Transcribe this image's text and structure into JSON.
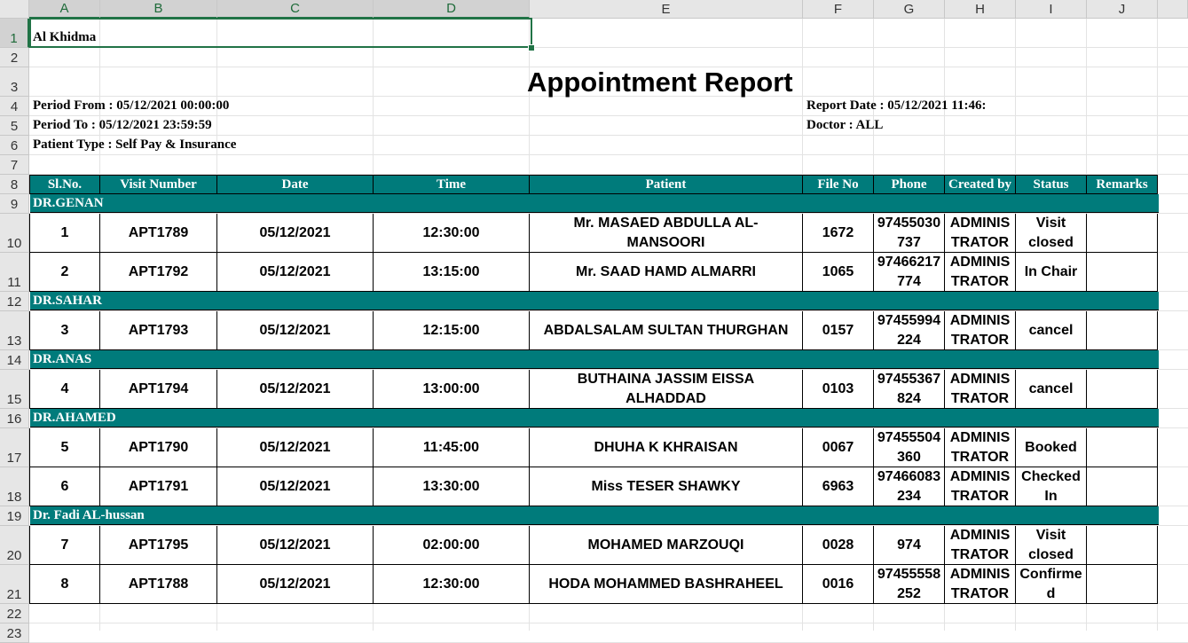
{
  "columns": [
    "A",
    "B",
    "C",
    "D",
    "E",
    "F",
    "G",
    "H",
    "I",
    "J"
  ],
  "rows": [
    "1",
    "2",
    "3",
    "4",
    "5",
    "6",
    "7",
    "8",
    "9",
    "10",
    "11",
    "12",
    "13",
    "14",
    "15",
    "16",
    "17",
    "18",
    "19",
    "20",
    "21",
    "22",
    "23"
  ],
  "company": "Al Khidma",
  "title": "Appointment Report",
  "period_from": "Period From : 05/12/2021 00:00:00",
  "period_to": "Period To : 05/12/2021 23:59:59",
  "patient_type": "Patient Type : Self Pay & Insurance",
  "report_date": "Report Date : 05/12/2021 11:46:",
  "doctor": "Doctor : ALL",
  "colors": {
    "header_fill": "#007b7b",
    "header_text": "#ffffff",
    "selection": "#217346"
  },
  "table_headers": [
    "Sl.No.",
    "Visit Number",
    "Date",
    "Time",
    "Patient",
    "File No",
    "Phone",
    "Created by",
    "Status",
    "Remarks"
  ],
  "groups": [
    {
      "doctor": "DR.GENAN",
      "rows": [
        {
          "sl": "1",
          "visit": "APT1789",
          "date": "05/12/2021",
          "time": "12:30:00",
          "patient": "Mr. MASAED ABDULLA AL-\nMANSOORI",
          "file": "1672",
          "phone": "97455030\n737",
          "created": "ADMINIS\nTRATOR",
          "status": "Visit\nclosed",
          "remarks": ""
        },
        {
          "sl": "2",
          "visit": "APT1792",
          "date": "05/12/2021",
          "time": "13:15:00",
          "patient": "Mr. SAAD HAMD ALMARRI",
          "file": "1065",
          "phone": "97466217\n774",
          "created": "ADMINIS\nTRATOR",
          "status": "In Chair",
          "remarks": ""
        }
      ]
    },
    {
      "doctor": "DR.SAHAR",
      "rows": [
        {
          "sl": "3",
          "visit": "APT1793",
          "date": "05/12/2021",
          "time": "12:15:00",
          "patient": "ABDALSALAM SULTAN THURGHAN",
          "file": "0157",
          "phone": "97455994\n224",
          "created": "ADMINIS\nTRATOR",
          "status": "cancel",
          "remarks": ""
        }
      ]
    },
    {
      "doctor": "DR.ANAS",
      "rows": [
        {
          "sl": "4",
          "visit": "APT1794",
          "date": "05/12/2021",
          "time": "13:00:00",
          "patient": "BUTHAINA JASSIM EISSA\nALHADDAD",
          "file": "0103",
          "phone": "97455367\n824",
          "created": "ADMINIS\nTRATOR",
          "status": "cancel",
          "remarks": ""
        }
      ]
    },
    {
      "doctor": "DR.AHAMED",
      "rows": [
        {
          "sl": "5",
          "visit": "APT1790",
          "date": "05/12/2021",
          "time": "11:45:00",
          "patient": "DHUHA K KHRAISAN",
          "file": "0067",
          "phone": "97455504\n360",
          "created": "ADMINIS\nTRATOR",
          "status": "Booked",
          "remarks": ""
        },
        {
          "sl": "6",
          "visit": "APT1791",
          "date": "05/12/2021",
          "time": "13:30:00",
          "patient": "Miss TESER SHAWKY",
          "file": "6963",
          "phone": "97466083\n234",
          "created": "ADMINIS\nTRATOR",
          "status": "Checked\nIn",
          "remarks": ""
        }
      ]
    },
    {
      "doctor": "Dr. Fadi AL-hussan",
      "rows": [
        {
          "sl": "7",
          "visit": "APT1795",
          "date": "05/12/2021",
          "time": "02:00:00",
          "patient": "MOHAMED MARZOUQI",
          "file": "0028",
          "phone": "974",
          "created": "ADMINIS\nTRATOR",
          "status": "Visit\nclosed",
          "remarks": ""
        },
        {
          "sl": "8",
          "visit": "APT1788",
          "date": "05/12/2021",
          "time": "12:30:00",
          "patient": "HODA MOHAMMED BASHRAHEEL",
          "file": "0016",
          "phone": "97455558\n252",
          "created": "ADMINIS\nTRATOR",
          "status": "Confirme\nd",
          "remarks": ""
        }
      ]
    }
  ]
}
